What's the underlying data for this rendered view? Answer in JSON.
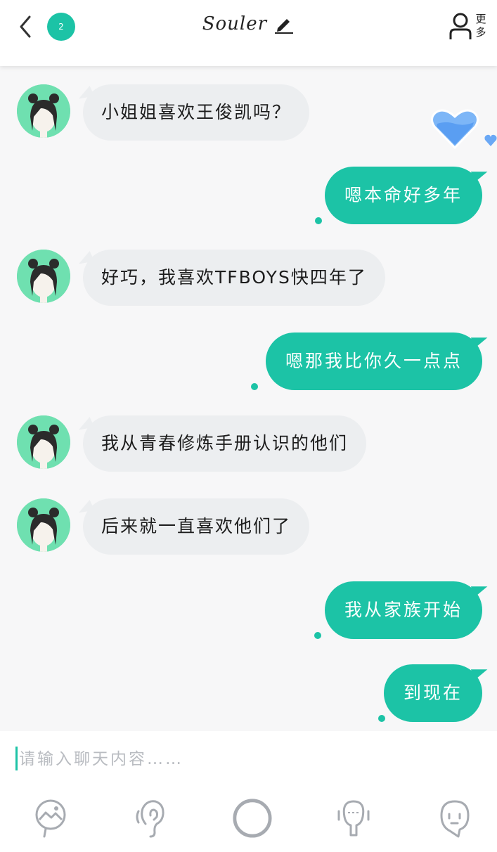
{
  "header": {
    "badge_count": "2",
    "title": "Souler",
    "more_label": "更多"
  },
  "colors": {
    "accent": "#1cc3a6",
    "incoming_bubble": "#eceef0",
    "avatar_bg": "#6fe0b0",
    "heart": "#6aa8f5"
  },
  "icons": {
    "back": "chevron-left-icon",
    "edit": "pencil-icon",
    "profile": "user-icon",
    "heart": "heart-icon",
    "toolbar": [
      "image-icon",
      "ear-icon",
      "circle-icon",
      "microphone-icon",
      "emoji-face-icon"
    ]
  },
  "messages": [
    {
      "side": "in",
      "text": "小姐姐喜欢王俊凯吗？"
    },
    {
      "side": "out",
      "text": "嗯本命好多年"
    },
    {
      "side": "in",
      "text": "好巧，我喜欢TFBOYS快四年了"
    },
    {
      "side": "out",
      "text": "嗯那我比你久一点点"
    },
    {
      "side": "in",
      "text": "我从青春修炼手册认识的他们"
    },
    {
      "side": "in",
      "text": "后来就一直喜欢他们了"
    },
    {
      "side": "out",
      "text": "我从家族开始"
    },
    {
      "side": "out",
      "text": "到现在"
    }
  ],
  "input": {
    "placeholder": "请输入聊天内容……",
    "value": ""
  }
}
